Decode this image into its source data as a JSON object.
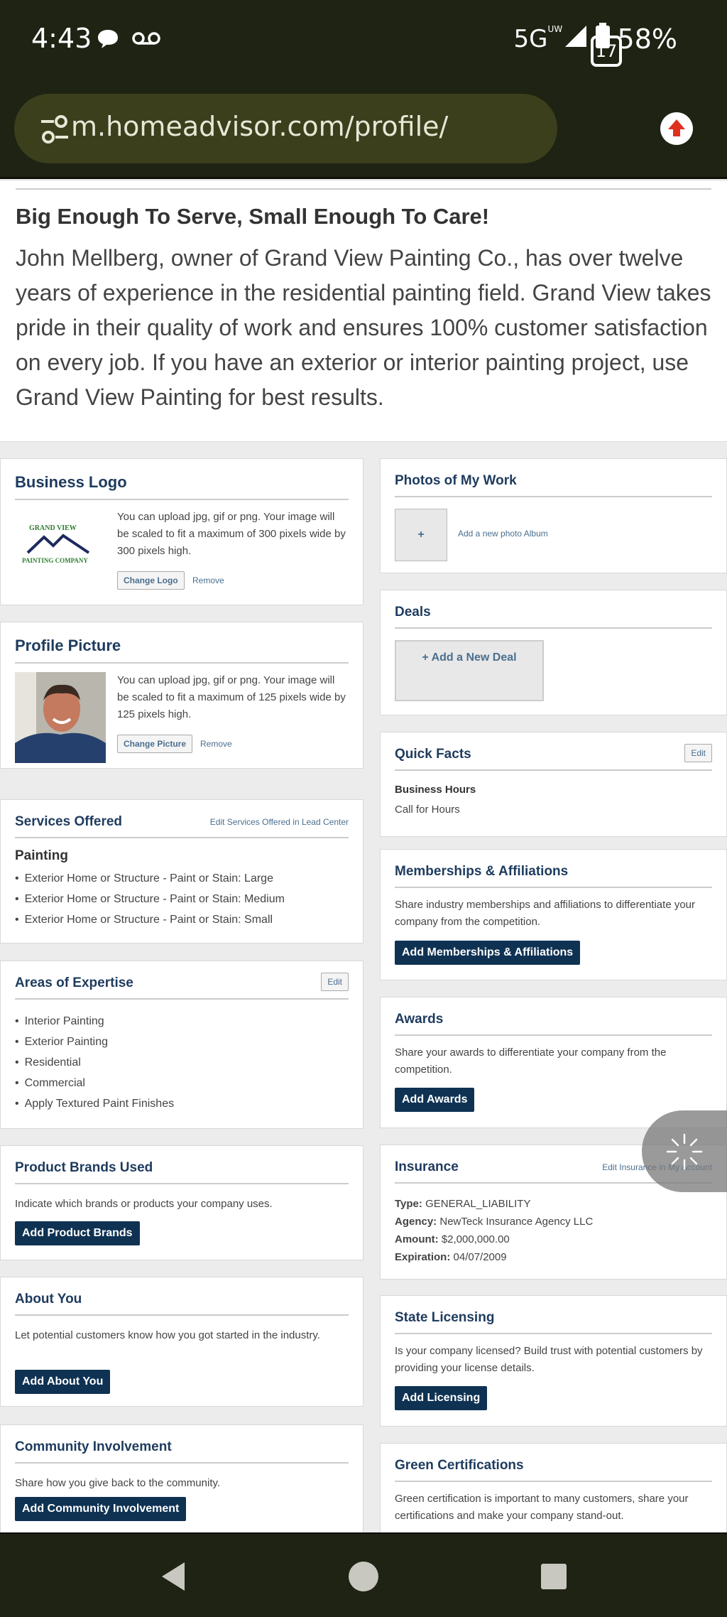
{
  "status": {
    "time": "4:43",
    "network": "5G",
    "network_super": "UW",
    "battery": "58%"
  },
  "browser": {
    "url": "m.homeadvisor.com/profile/",
    "tab_count": "17"
  },
  "bio": {
    "title": "Big Enough To Serve, Small Enough To Care!",
    "text": "John Mellberg, owner of Grand View Painting Co., has over twelve years of experience in the residential painting field. Grand View takes pride in their quality of work and ensures 100% customer satisfaction on every job. If you have an exterior or interior painting project, use Grand View Painting for best results."
  },
  "business_logo": {
    "title": "Business Logo",
    "text": "You can upload jpg, gif or png. Your image will be scaled to fit a maximum of 300 pixels wide by 300 pixels high.",
    "change": "Change Logo",
    "remove": "Remove",
    "logo_line1": "GRAND VIEW",
    "logo_line2": "PAINTING COMPANY"
  },
  "profile_picture": {
    "title": "Profile Picture",
    "text": "You can upload jpg, gif or png. Your image will be scaled to fit a maximum of 125 pixels wide by 125 pixels high.",
    "change": "Change Picture",
    "remove": "Remove"
  },
  "services": {
    "title": "Services Offered",
    "edit_link": "Edit Services Offered in Lead Center",
    "category": "Painting",
    "items": [
      "Exterior Home or Structure - Paint or Stain: Large",
      "Exterior Home or Structure - Paint or Stain: Medium",
      "Exterior Home or Structure - Paint or Stain: Small"
    ]
  },
  "expertise": {
    "title": "Areas of Expertise",
    "edit": "Edit",
    "items": [
      "Interior Painting",
      "Exterior Painting",
      "Residential",
      "Commercial",
      "Apply Textured Paint Finishes"
    ]
  },
  "product_brands": {
    "title": "Product Brands Used",
    "text": "Indicate which brands or products your company uses.",
    "button": "Add Product Brands"
  },
  "about_you": {
    "title": "About You",
    "text": "Let potential customers know how you got started in the industry.",
    "button": "Add About You"
  },
  "community": {
    "title": "Community Involvement",
    "text": "Share how you give back to the community.",
    "button": "Add Community Involvement"
  },
  "photos": {
    "title": "Photos of My Work",
    "plus": "+",
    "link": "Add a new photo Album"
  },
  "deals": {
    "title": "Deals",
    "button": "+ Add a New Deal"
  },
  "quick_facts": {
    "title": "Quick Facts",
    "edit": "Edit",
    "label": "Business Hours",
    "value": "Call for Hours"
  },
  "memberships": {
    "title": "Memberships & Affiliations",
    "text": "Share industry memberships and affiliations to differentiate your company from the competition.",
    "button": "Add Memberships & Affiliations"
  },
  "awards": {
    "title": "Awards",
    "text": "Share your awards to differentiate your company from the competition.",
    "button": "Add Awards"
  },
  "insurance": {
    "title": "Insurance",
    "edit_link": "Edit Insurance in My Account",
    "type_label": "Type:",
    "type": "GENERAL_LIABILITY",
    "agency_label": "Agency:",
    "agency": "NewTeck Insurance Agency LLC",
    "amount_label": "Amount:",
    "amount": "$2,000,000.00",
    "expiration_label": "Expiration:",
    "expiration": "04/07/2009"
  },
  "licensing": {
    "title": "State Licensing",
    "text": "Is your company licensed? Build trust with potential customers by providing your license details.",
    "button": "Add Licensing"
  },
  "green": {
    "title": "Green Certifications",
    "text": "Green certification is important to many customers, share your certifications and make your company stand-out."
  },
  "colors": {
    "navy": "#0f3253",
    "heading": "#1e3b5e",
    "chrome": "#1e2313"
  }
}
